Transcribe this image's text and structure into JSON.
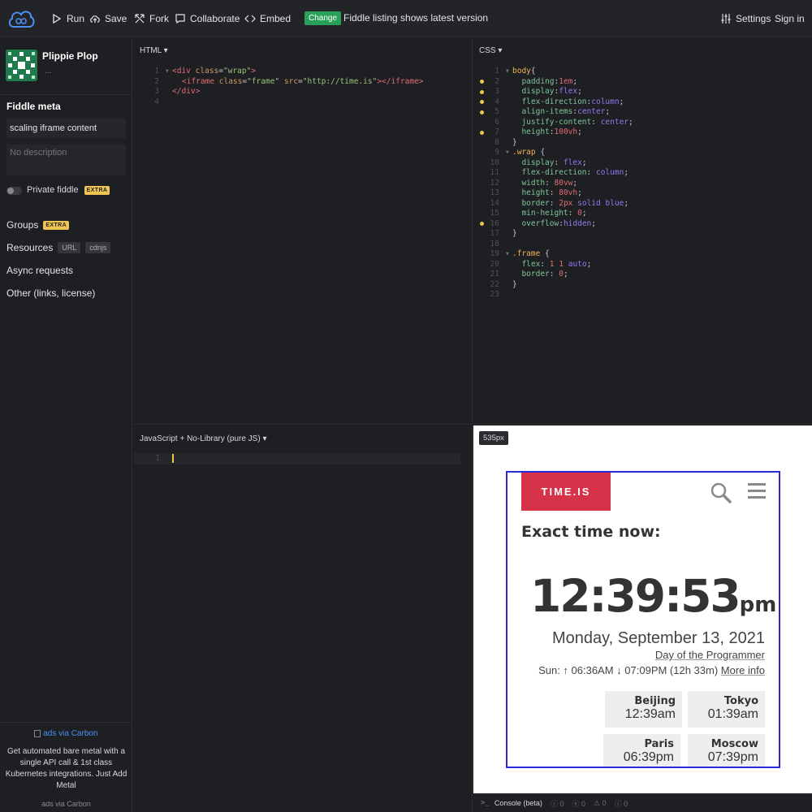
{
  "toolbar": {
    "run": "Run",
    "save": "Save",
    "fork": "Fork",
    "collaborate": "Collaborate",
    "embed": "Embed",
    "change_badge": "Change",
    "listing_text": "Fiddle listing shows latest version",
    "settings": "Settings",
    "sign_in": "Sign in"
  },
  "sidebar": {
    "user_name": "Plippie Plop",
    "user_sub": "...",
    "meta_title": "Fiddle meta",
    "fiddle_title": "scaling iframe content",
    "description_placeholder": "No description",
    "private_label": "Private fiddle",
    "extra_badge": "EXTRA",
    "groups": "Groups",
    "resources": "Resources",
    "url_pill": "URL",
    "cdnjs_pill": "cdnjs",
    "async": "Async requests",
    "other": "Other (links, license)",
    "carbon_img_alt": "ads via Carbon",
    "carbon_text": "Get automated bare metal with a single API call & 1st class Kubernetes integrations. Just Add Metal",
    "carbon_foot": "ads via Carbon"
  },
  "panels": {
    "html_label": "HTML ▾",
    "css_label": "CSS ▾",
    "js_label": "JavaScript + No-Library (pure JS) ▾",
    "size_badge": "535px"
  },
  "html_code": {
    "line_numbers": [
      "1",
      "2",
      "3",
      "4"
    ],
    "line1": [
      "<div ",
      "class",
      "=",
      "\"wrap\"",
      ">"
    ],
    "line2": [
      "<iframe ",
      "class",
      "=",
      "\"frame\"",
      " src",
      "=",
      "\"http://time.is\"",
      "></",
      "iframe",
      ">"
    ],
    "line3": [
      "</div>"
    ]
  },
  "css_code": {
    "line_numbers": [
      "1",
      "2",
      "3",
      "4",
      "5",
      "6",
      "7",
      "8",
      "9",
      "10",
      "11",
      "12",
      "13",
      "14",
      "15",
      "16",
      "17",
      "18",
      "19",
      "20",
      "21",
      "22",
      "23"
    ],
    "lines": [
      "body{",
      "  padding:1em;",
      "  display:flex;",
      "  flex-direction:column;",
      "  align-items:center;",
      "  justify-content: center;",
      "  height:100vh;",
      "}",
      ".wrap {",
      "  display: flex;",
      "  flex-direction: column;",
      "  width: 80vw;",
      "  height: 80vh;",
      "  border: 2px solid blue;",
      "  min-height: 0;",
      "  overflow:hidden;",
      "}",
      "",
      ".frame {",
      "  flex: 1 1 auto;",
      "  border: 0;",
      "}",
      ""
    ]
  },
  "js_code": {
    "line_numbers": [
      "1"
    ]
  },
  "result": {
    "logo": "TIME.IS",
    "heading": "Exact time now:",
    "time": "12:39:53",
    "ampm": "pm",
    "date": "Monday, September 13, 2021",
    "special_day": "Day of the Programmer",
    "sun_prefix": "Sun: ↑ 06:36AM ↓ 07:09PM (12h 33m) ",
    "more_info": "More info",
    "cities": [
      {
        "name": "Beijing",
        "time": "12:39am"
      },
      {
        "name": "Tokyo",
        "time": "01:39am"
      },
      {
        "name": "Paris",
        "time": "06:39pm"
      },
      {
        "name": "Moscow",
        "time": "07:39pm"
      }
    ]
  },
  "console": {
    "label": "Console (beta)",
    "counts": [
      "0",
      "0",
      "0",
      "0"
    ]
  },
  "colors": {
    "brand_blue": "#4d8ff5",
    "change_green": "#29a05a",
    "extra_yellow": "#f0c451",
    "timeis_red": "#d6334a",
    "frame_border": "#2a2ad8"
  }
}
